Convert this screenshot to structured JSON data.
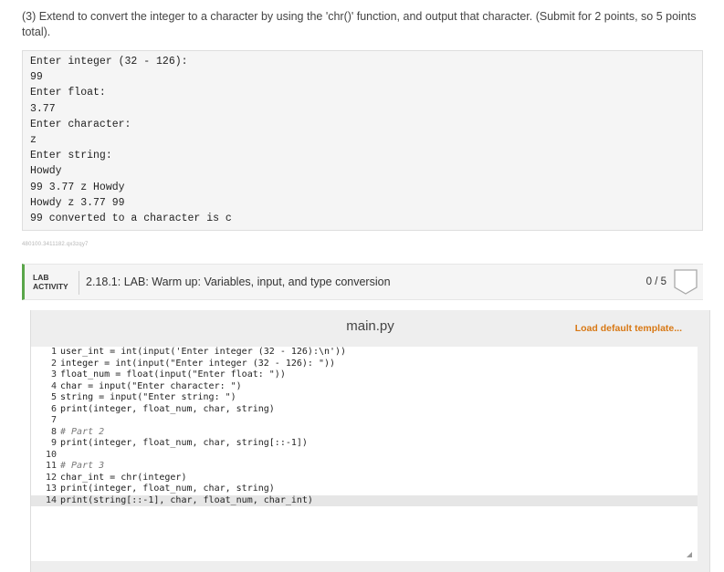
{
  "instruction": "(3) Extend to convert the integer to a character by using the 'chr()' function, and output that character. (Submit for 2 points, so 5 points total).",
  "sample_output": [
    "Enter integer (32 - 126):",
    "99",
    "Enter float:",
    "3.77",
    "Enter character:",
    "z",
    "Enter string:",
    "Howdy",
    "99 3.77 z Howdy",
    "Howdy z 3.77 99",
    "99 converted to a character is c"
  ],
  "lab_id": "480100.3411182.qx3zqy7",
  "lab": {
    "tag_line1": "LAB",
    "tag_line2": "ACTIVITY",
    "title": "2.18.1: LAB: Warm up: Variables, input, and type conversion",
    "score": "0 / 5"
  },
  "editor": {
    "filename": "main.py",
    "load_template": "Load default template...",
    "lines": [
      {
        "n": "1",
        "text": "user_int = int(input('Enter integer (32 - 126):\\n'))"
      },
      {
        "n": "2",
        "text": "integer = int(input(\"Enter integer (32 - 126): \"))"
      },
      {
        "n": "3",
        "text": "float_num = float(input(\"Enter float: \"))"
      },
      {
        "n": "4",
        "text": "char = input(\"Enter character: \")"
      },
      {
        "n": "5",
        "text": "string = input(\"Enter string: \")"
      },
      {
        "n": "6",
        "text": "print(integer, float_num, char, string)"
      },
      {
        "n": "7",
        "text": ""
      },
      {
        "n": "8",
        "text": "# Part 2"
      },
      {
        "n": "9",
        "text": "print(integer, float_num, char, string[::-1])"
      },
      {
        "n": "10",
        "text": ""
      },
      {
        "n": "11",
        "text": "# Part 3"
      },
      {
        "n": "12",
        "text": "char_int = chr(integer)"
      },
      {
        "n": "13",
        "text": "print(integer, float_num, char, string)"
      },
      {
        "n": "14",
        "text": "print(string[::-1], char, float_num, char_int)"
      }
    ]
  },
  "colors": {
    "accent_green": "#5aa64a",
    "link_orange": "#d87814"
  }
}
